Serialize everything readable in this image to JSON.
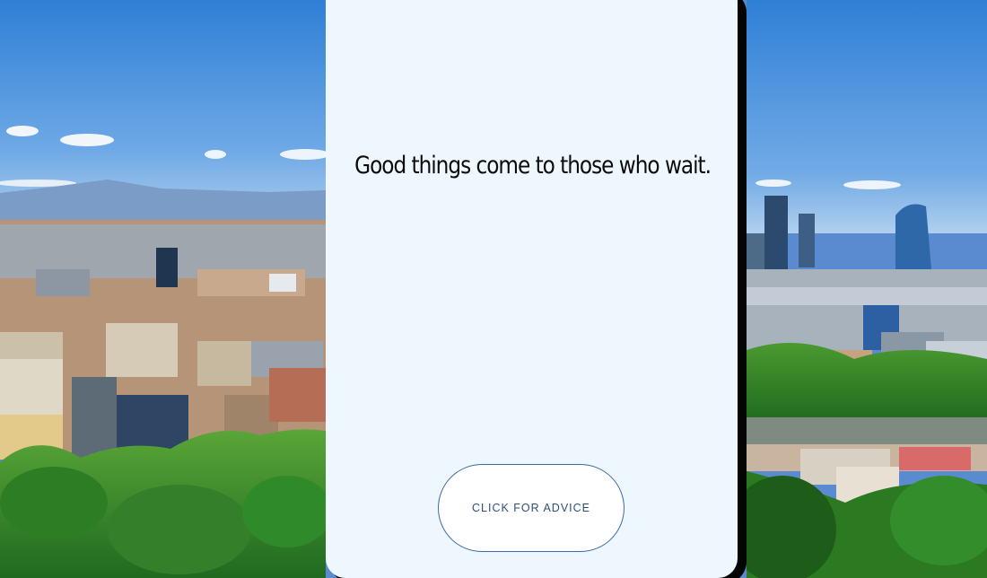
{
  "advice": {
    "text": "Good things come to those who wait."
  },
  "button": {
    "label": "CLICK FOR ADVICE"
  },
  "background": {
    "description_icon": "city-skyline-photo",
    "sky_color": "#4d8fd6",
    "foliage_color": "#3f8f2f"
  }
}
